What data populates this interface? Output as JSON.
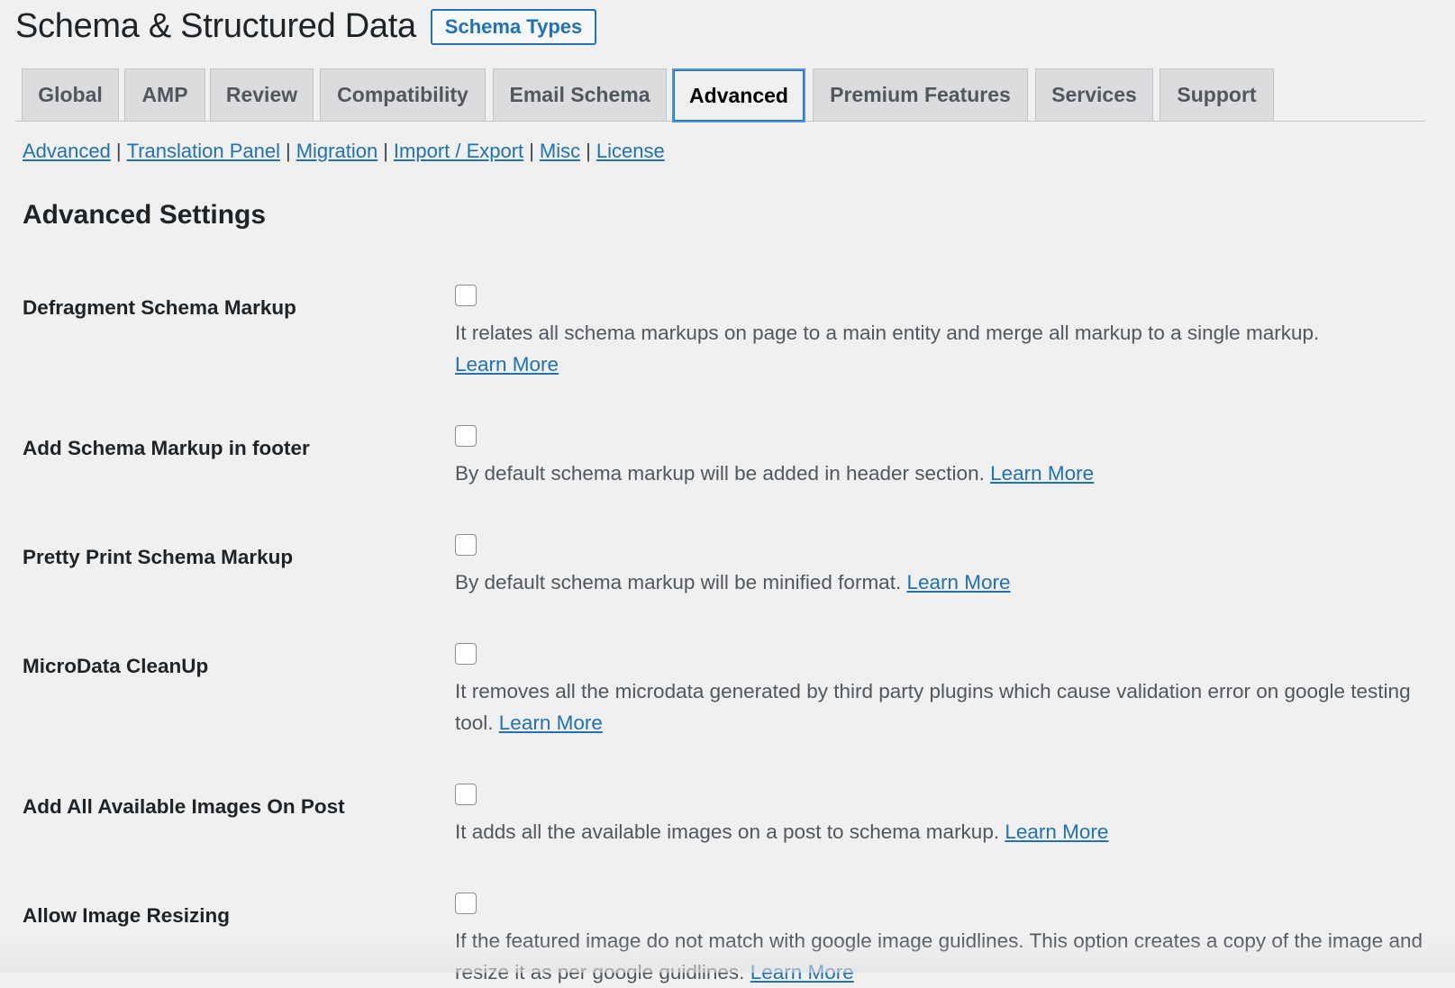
{
  "header": {
    "title": "Schema & Structured Data",
    "button_label": "Schema Types"
  },
  "tabs": [
    {
      "label": "Global"
    },
    {
      "label": "AMP"
    },
    {
      "label": "Review"
    },
    {
      "label": "Compatibility"
    },
    {
      "label": "Email Schema"
    },
    {
      "label": "Advanced",
      "active": true
    },
    {
      "label": "Premium Features"
    },
    {
      "label": "Services"
    },
    {
      "label": "Support"
    }
  ],
  "subnav": {
    "links": [
      "Advanced",
      "Translation Panel",
      "Migration",
      "Import / Export",
      "Misc",
      "License"
    ],
    "separator": "|"
  },
  "section_title": "Advanced Settings",
  "settings": [
    {
      "label": "Defragment Schema Markup",
      "checked": false,
      "description": "It relates all schema markups on page to a main entity and merge all markup to a single markup.",
      "link": "Learn More"
    },
    {
      "label": "Add Schema Markup in footer",
      "checked": false,
      "description": "By default schema markup will be added in header section.",
      "link": "Learn More"
    },
    {
      "label": "Pretty Print Schema Markup",
      "checked": false,
      "description": "By default schema markup will be minified format.",
      "link": "Learn More"
    },
    {
      "label": "MicroData CleanUp",
      "checked": false,
      "description": "It removes all the microdata generated by third party plugins which cause validation error on google testing tool.",
      "link": "Learn More"
    },
    {
      "label": "Add All Available Images On Post",
      "checked": false,
      "description": "It adds all the available images on a post to schema markup.",
      "link": "Learn More"
    },
    {
      "label": "Allow Image Resizing",
      "checked": false,
      "description": "If the featured image do not match with google image guidlines. This option creates a copy of the image and resize it as per google guidlines.",
      "link": "Learn More"
    }
  ],
  "colors": {
    "accent": "#2271b1",
    "background": "#f0f0f1",
    "tab_inactive": "#dcdcde",
    "active_tab_border": "#4f94d4"
  }
}
